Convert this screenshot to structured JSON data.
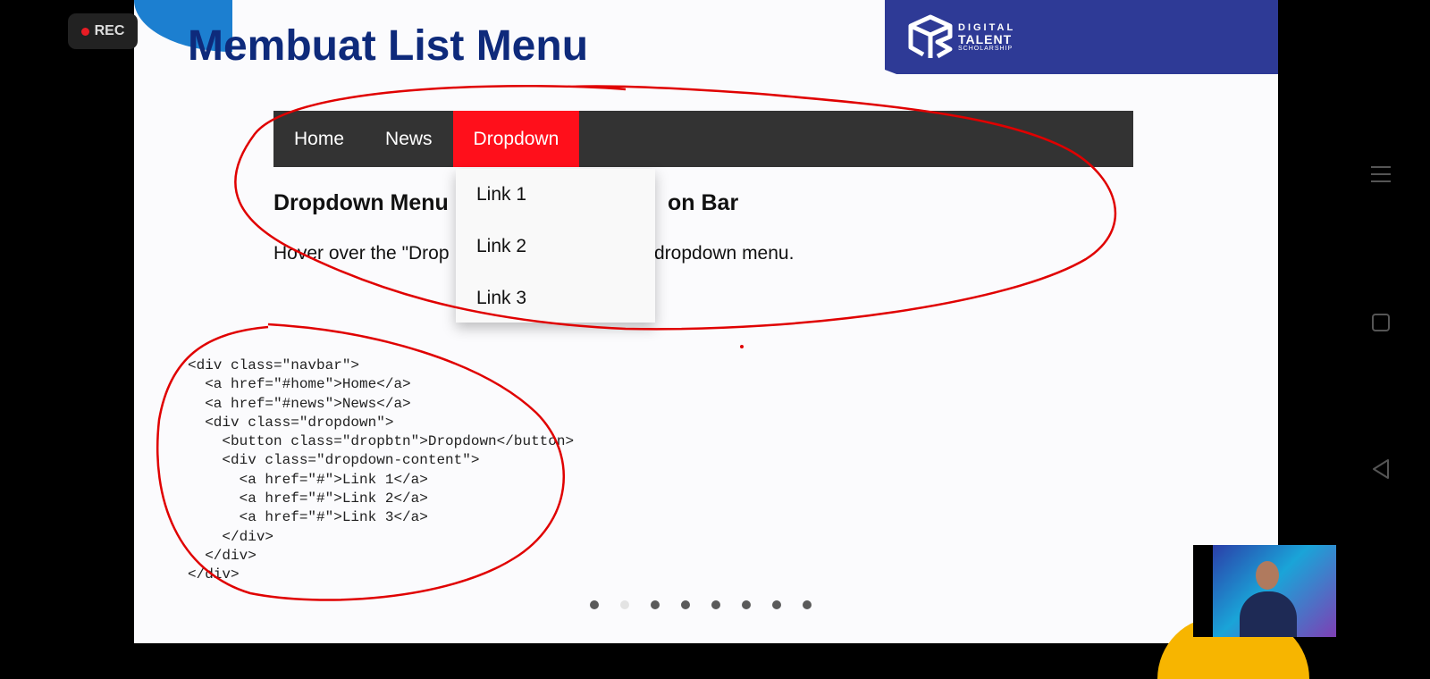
{
  "recording": {
    "label": "REC"
  },
  "slide": {
    "title": "Membuat List Menu",
    "brand": {
      "line1": "DIGITAL",
      "line2": "TALENT",
      "line3": "SCHOLARSHIP"
    }
  },
  "demo": {
    "navbar": [
      "Home",
      "News",
      "Dropdown"
    ],
    "dropdown_links": [
      "Link 1",
      "Link 2",
      "Link 3"
    ],
    "heading": "Dropdown Menu",
    "heading_tail": "on Bar",
    "text_before": "Hover over the \"Drop",
    "text_after": "dropdown menu."
  },
  "code_sample": "<div class=\"navbar\">\n  <a href=\"#home\">Home</a>\n  <a href=\"#news\">News</a>\n  <div class=\"dropdown\">\n    <button class=\"dropbtn\">Dropdown</button>\n    <div class=\"dropdown-content\">\n      <a href=\"#\">Link 1</a>\n      <a href=\"#\">Link 2</a>\n      <a href=\"#\">Link 3</a>\n    </div>\n  </div>\n</div>",
  "pagination": {
    "total": 8,
    "current_index": 2
  },
  "colors": {
    "title": "#0e2a7b",
    "navbar_bg": "#333333",
    "active_item": "#ff0f1b",
    "annotation": "#e00000",
    "brand_bg": "#2e3a96"
  },
  "system_nav_icons": [
    "menu-icon",
    "square-icon",
    "back-triangle-icon"
  ]
}
